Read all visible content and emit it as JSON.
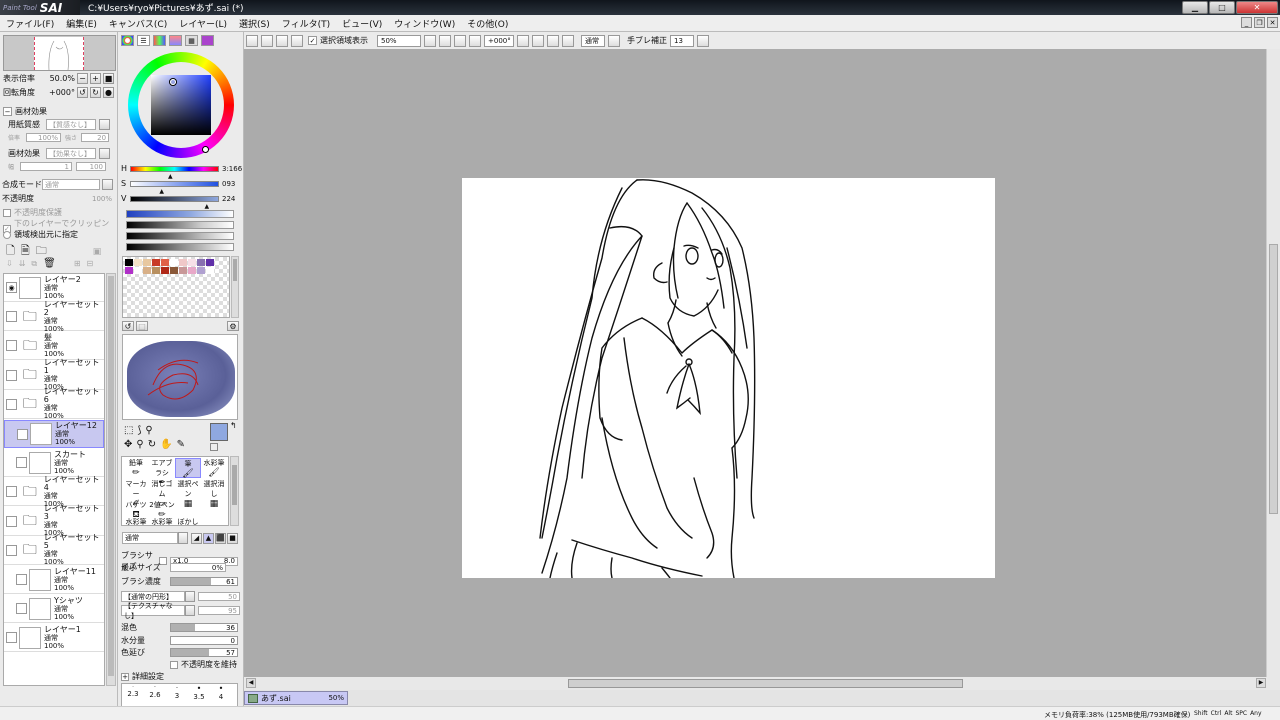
{
  "title": {
    "app_brand_small": "Paint Tool",
    "app_brand": "SAI",
    "path": "C:¥Users¥ryo¥Pictures¥あず.sai (*)"
  },
  "menu": [
    "ファイル(F)",
    "編集(E)",
    "キャンバス(C)",
    "レイヤー(L)",
    "選択(S)",
    "フィルタ(T)",
    "ビュー(V)",
    "ウィンドウ(W)",
    "その他(O)"
  ],
  "navigator": {
    "zoom_label": "表示倍率",
    "zoom_value": "50.0%",
    "rotation_label": "回転角度",
    "rotation_value": "+000°"
  },
  "paper_effect": {
    "header": "画材効果",
    "texture_label": "用紙質感",
    "texture_value": "【質感なし】",
    "rate_label": "倍率",
    "rate_value": "100%",
    "strength_label": "強さ",
    "strength_value": "20",
    "effect_label": "画材効果",
    "effect_value": "【効果なし】",
    "width_label": "幅",
    "width_value": "1",
    "strength2_value": "100"
  },
  "blend": {
    "mode_label": "合成モード",
    "mode_value": "通常",
    "opacity_label": "不透明度",
    "opacity_value": "100%"
  },
  "layer_options": [
    "不透明度保護",
    "下のレイヤーでクリッピング",
    "領域検出元に指定"
  ],
  "layers": [
    {
      "name": "レイヤー2",
      "mode": "通常",
      "opacity": "100%",
      "type": "layer",
      "visible": true
    },
    {
      "name": "レイヤーセット2",
      "mode": "通常",
      "opacity": "100%",
      "type": "folder"
    },
    {
      "name": "髪",
      "mode": "通常",
      "opacity": "100%",
      "type": "folder"
    },
    {
      "name": "レイヤーセット1",
      "mode": "通常",
      "opacity": "100%",
      "type": "folder"
    },
    {
      "name": "レイヤーセット6",
      "mode": "通常",
      "opacity": "100%",
      "type": "folder"
    },
    {
      "name": "レイヤー12",
      "mode": "通常",
      "opacity": "100%",
      "type": "layer",
      "selected": true
    },
    {
      "name": "スカート",
      "mode": "通常",
      "opacity": "100%",
      "type": "layer"
    },
    {
      "name": "レイヤーセット4",
      "mode": "通常",
      "opacity": "100%",
      "type": "folder"
    },
    {
      "name": "レイヤーセット3",
      "mode": "通常",
      "opacity": "100%",
      "type": "folder"
    },
    {
      "name": "レイヤーセット5",
      "mode": "通常",
      "opacity": "100%",
      "type": "folder"
    },
    {
      "name": "レイヤー11",
      "mode": "通常",
      "opacity": "100%",
      "type": "layer"
    },
    {
      "name": "Yシャツ",
      "mode": "通常",
      "opacity": "100%",
      "type": "layer"
    },
    {
      "name": "レイヤー1",
      "mode": "通常",
      "opacity": "100%",
      "type": "layer"
    }
  ],
  "color": {
    "h_label": "H",
    "h_value": "3:166",
    "h_level": 0.46,
    "s_label": "S",
    "s_value": "093",
    "s_level": 0.36,
    "v_label": "V",
    "v_value": "224",
    "v_level": 0.88,
    "current": "#8fa8e0",
    "swatches": [
      "#000000",
      "#f4e2c8",
      "#e8c8a0",
      "#c83c28",
      "#e06048",
      "#ffffff",
      "#f0c8c8",
      "#f8e0e8",
      "#8870b0",
      "#6030a8",
      "#b030c8",
      "#ffffff",
      "#d8b088",
      "#b89060",
      "#b02818",
      "#8a5838",
      "#c89898",
      "#e8a8c8",
      "#b0a0d0",
      "#ffffff"
    ]
  },
  "tools": {
    "names": [
      "鉛筆",
      "エアブラシ",
      "筆",
      "水彩筆",
      "マーカー",
      "消しゴム",
      "選択ペン",
      "選択消し",
      "バケツ",
      "2値ペン",
      "水彩筆",
      "水彩筆",
      "ぼかし"
    ]
  },
  "brush": {
    "mode_value": "通常",
    "size_label": "ブラシサイズ",
    "size_mult": "x1.0",
    "size_value": "8.0",
    "min_label": "最小サイズ",
    "min_value": "0%",
    "density_label": "ブラシ濃度",
    "density_value": "61",
    "density_level": 0.61,
    "shape_value": "【通常の円形】",
    "shape_strength": "50",
    "texture_value": "【テクスチャなし】",
    "texture_strength": "95",
    "blend_label": "混色",
    "blend_value": "36",
    "blend_level": 0.36,
    "water_label": "水分量",
    "water_value": "0",
    "water_level": 0,
    "stretch_label": "色延び",
    "stretch_value": "57",
    "stretch_level": 0.57,
    "keep_label": "不透明度を維持",
    "detail_label": "詳細設定",
    "sizes": [
      "2.3",
      "2.6",
      "3",
      "3.5",
      "4"
    ]
  },
  "toolbar": {
    "show_selection_label": "選択領域表示",
    "zoom_value": "50%",
    "angle_value": "+000°",
    "blend_value": "通常",
    "stabilizer_label": "手ブレ補正",
    "stabilizer_value": "13"
  },
  "tab": {
    "name": "あず.sai",
    "zoom": "50%"
  },
  "status": {
    "memory": "メモリ負荷率:38% (125MB使用/793MB確保)",
    "keys": [
      "Shift",
      "Ctrl",
      "Alt",
      "SPC",
      "Any"
    ]
  }
}
